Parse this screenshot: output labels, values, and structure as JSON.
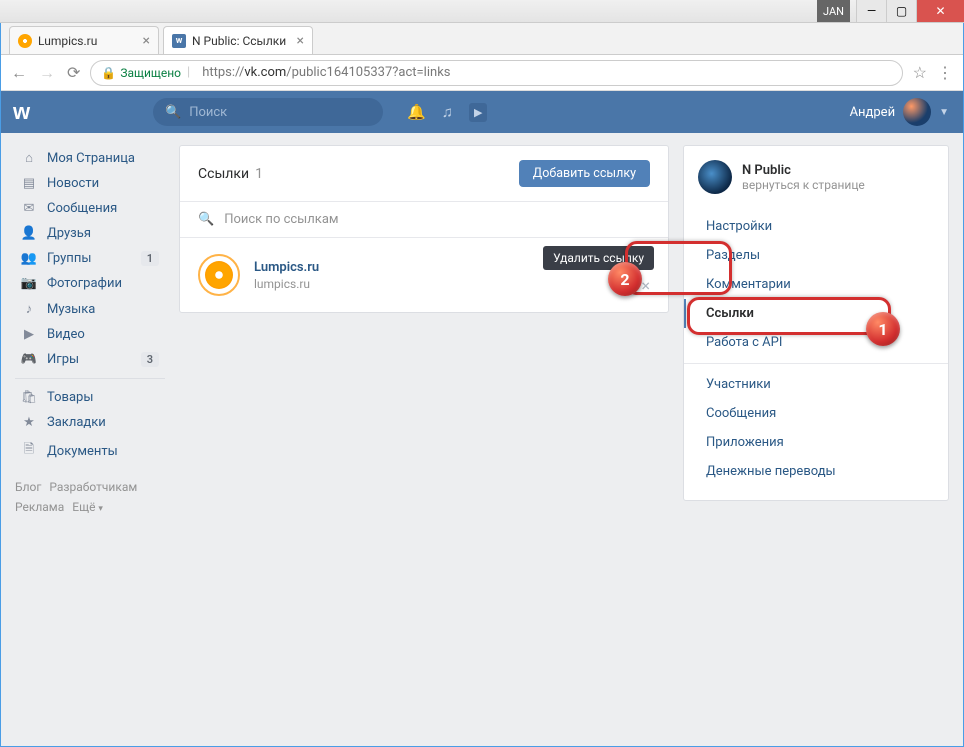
{
  "window": {
    "jan": "JAN"
  },
  "tabs": [
    {
      "title": "Lumpics.ru"
    },
    {
      "title": "N Public: Ссылки",
      "favicon_letter": "w"
    }
  ],
  "addr": {
    "secure": "Защищено",
    "scheme": "https://",
    "host": "vk.com",
    "path": "/public164105337?act=links"
  },
  "vk_header": {
    "logo": "w",
    "search_placeholder": "Поиск",
    "user": "Андрей"
  },
  "left_nav": {
    "items": [
      {
        "id": "my-page",
        "label": "Моя Страница",
        "icon": "⌂"
      },
      {
        "id": "news",
        "label": "Новости",
        "icon": "▤"
      },
      {
        "id": "messages",
        "label": "Сообщения",
        "icon": "✉"
      },
      {
        "id": "friends",
        "label": "Друзья",
        "icon": "👤"
      },
      {
        "id": "groups",
        "label": "Группы",
        "icon": "👥",
        "badge": "1"
      },
      {
        "id": "photos",
        "label": "Фотографии",
        "icon": "📷"
      },
      {
        "id": "music",
        "label": "Музыка",
        "icon": "♪"
      },
      {
        "id": "videos",
        "label": "Видео",
        "icon": "▶"
      },
      {
        "id": "games",
        "label": "Игры",
        "icon": "🎮",
        "badge": "3"
      }
    ],
    "items2": [
      {
        "id": "market",
        "label": "Товары",
        "icon": "🛍"
      },
      {
        "id": "bookmarks",
        "label": "Закладки",
        "icon": "★"
      },
      {
        "id": "documents",
        "label": "Документы",
        "icon": "🗎"
      }
    ]
  },
  "footer": {
    "blog": "Блог",
    "devs": "Разработчикам",
    "ads": "Реклама",
    "more": "Ещё"
  },
  "main": {
    "title": "Ссылки",
    "count": "1",
    "add_button": "Добавить ссылку",
    "search_placeholder": "Поиск по ссылкам",
    "link": {
      "title": "Lumpics.ru",
      "url": "lumpics.ru"
    },
    "tooltip": "Удалить ссылку"
  },
  "right": {
    "group_name": "N Public",
    "back": "вернуться к странице",
    "menu": [
      "Настройки",
      "Разделы",
      "Комментарии",
      "Ссылки",
      "Работа с API"
    ],
    "menu2": [
      "Участники",
      "Сообщения",
      "Приложения",
      "Денежные переводы"
    ]
  },
  "anno": {
    "one": "1",
    "two": "2"
  }
}
